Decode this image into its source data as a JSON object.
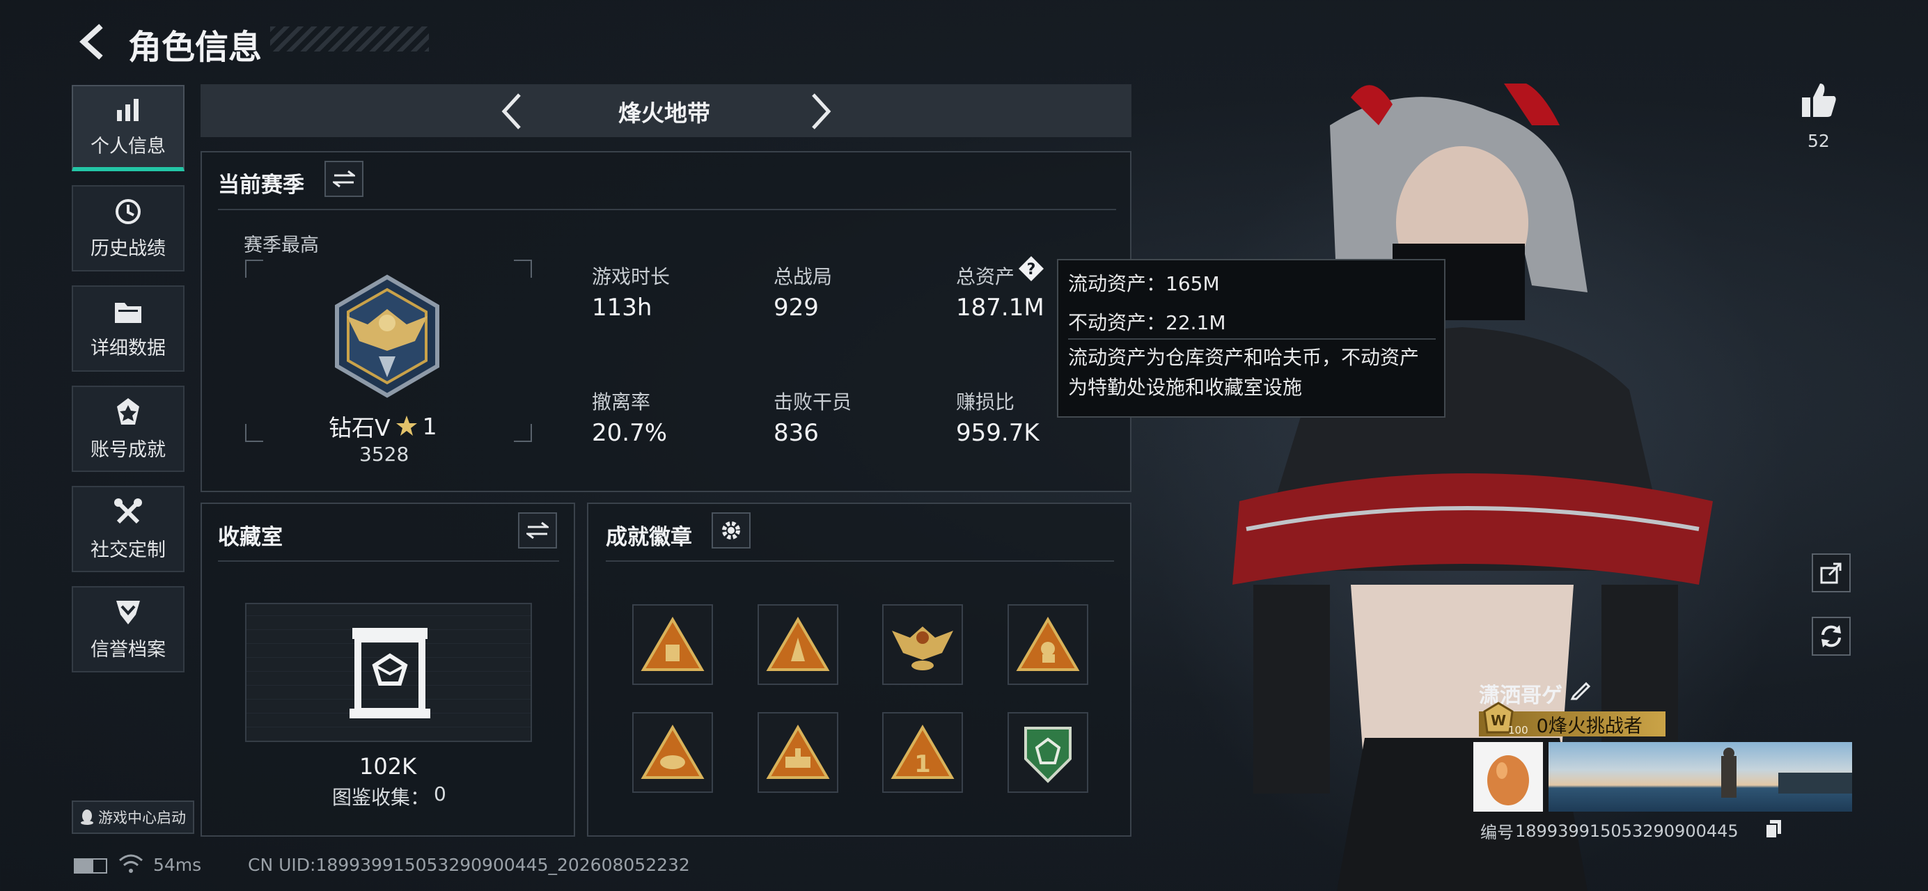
{
  "header": {
    "title": "角色信息"
  },
  "sidebar": {
    "items": [
      {
        "label": "个人信息",
        "icon": "bar-chart-icon",
        "active": true
      },
      {
        "label": "历史战绩",
        "icon": "history-icon"
      },
      {
        "label": "详细数据",
        "icon": "folder-icon"
      },
      {
        "label": "账号成就",
        "icon": "achievement-icon"
      },
      {
        "label": "社交定制",
        "icon": "tools-icon"
      },
      {
        "label": "信誉档案",
        "icon": "shield-icon"
      }
    ],
    "launcher_label": "游戏中心启动"
  },
  "mode_selector": {
    "label": "烽火地带"
  },
  "season": {
    "title": "当前赛季",
    "best_label": "赛季最高",
    "rank_name": "钻石V",
    "rank_stars": "1",
    "rank_score": "3528",
    "stats": [
      {
        "label": "游戏时长",
        "value": "113h"
      },
      {
        "label": "总战局",
        "value": "929"
      },
      {
        "label": "总资产",
        "value": "187.1M"
      },
      {
        "label": "撤离率",
        "value": "20.7%"
      },
      {
        "label": "击败干员",
        "value": "836"
      },
      {
        "label": "赚损比",
        "value": "959.7K"
      }
    ]
  },
  "tooltip": {
    "line1": "流动资产：165M",
    "line2": "不动资产：22.1M",
    "desc_line1": "流动资产为仓库资产和哈夫币，不动资产",
    "desc_line2": "为特勤处设施和收藏室设施"
  },
  "collection": {
    "title": "收藏室",
    "value": "102K",
    "codex_label": "图鉴收集：",
    "codex_value": "0"
  },
  "achievements": {
    "title": "成就徽章",
    "badges": [
      "badge-1",
      "badge-2",
      "badge-3",
      "badge-4",
      "badge-5",
      "badge-6",
      "badge-7",
      "badge-8"
    ]
  },
  "profile": {
    "likes": "52",
    "name": "潇洒哥ゲ",
    "level": "100",
    "title_badge": "0烽火挑战者",
    "id_label": "编号",
    "id_value": "1899399150532909004​45"
  },
  "status_bar": {
    "ping": "54ms",
    "uid": "CN UID:189939915053290900445_202608052232"
  },
  "colors": {
    "accent": "#23c6a6",
    "gold": "#c9a24a",
    "panel_border": "#3a424b"
  }
}
